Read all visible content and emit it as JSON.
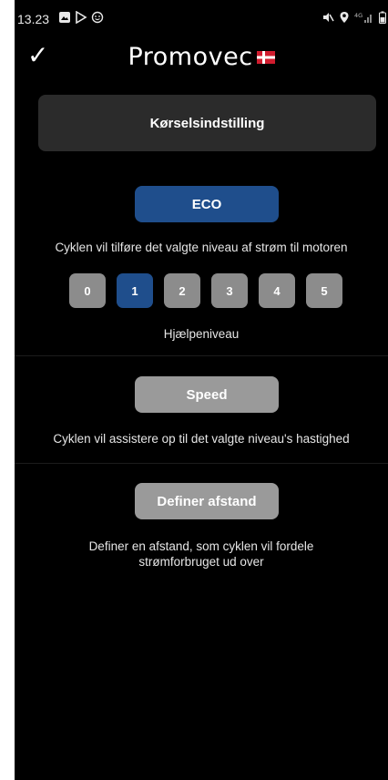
{
  "status": {
    "time": "13.23",
    "left_icons": [
      "image-icon",
      "play-store-icon",
      "emoji-icon"
    ],
    "right_icons": [
      "mute-icon",
      "location-icon",
      "signal-icon",
      "battery-icon"
    ],
    "network_text": "4G"
  },
  "topbar": {
    "check_symbol": "✓",
    "brand": "Promovec"
  },
  "header": {
    "title": "Kørselsindstilling"
  },
  "eco": {
    "label": "ECO",
    "description": "Cyklen vil tilføre det valgte niveau af strøm til motoren",
    "levels": [
      "0",
      "1",
      "2",
      "3",
      "4",
      "5"
    ],
    "selected_level": "1",
    "levels_caption": "Hjælpeniveau"
  },
  "speed": {
    "label": "Speed",
    "description": "Cyklen vil assistere op til det valgte niveau's hastighed"
  },
  "distance": {
    "label": "Definer afstand",
    "description_line1": "Definer en afstand, som cyklen vil fordele",
    "description_line2": "strømforbruget ud over"
  },
  "colors": {
    "accent": "#1f4e8c",
    "inactive": "#9a9a9a",
    "card": "#2b2b2b",
    "background": "#000000"
  }
}
